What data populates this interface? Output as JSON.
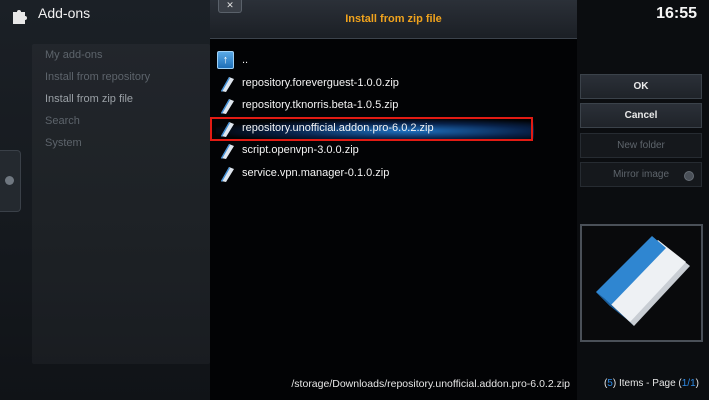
{
  "app": {
    "title": "Add-ons",
    "clock": "16:55"
  },
  "sidebar": {
    "items": [
      {
        "label": "My add-ons"
      },
      {
        "label": "Install from repository"
      },
      {
        "label": "Install from zip file"
      },
      {
        "label": "Search"
      },
      {
        "label": "System"
      }
    ],
    "selected": "Install from zip file"
  },
  "dialog": {
    "title": "Install from zip file",
    "close_label": "✕",
    "up_label": "..",
    "files": [
      {
        "name": "repository.foreverguest-1.0.0.zip"
      },
      {
        "name": "repository.tknorris.beta-1.0.5.zip"
      },
      {
        "name": "repository.unofficial.addon.pro-6.0.2.zip"
      },
      {
        "name": "script.openvpn-3.0.0.zip"
      },
      {
        "name": "service.vpn.manager-0.1.0.zip"
      }
    ],
    "highlighted": "repository.unofficial.addon.pro-6.0.2.zip",
    "path": "/storage/Downloads/repository.unofficial.addon.pro-6.0.2.zip"
  },
  "buttons": {
    "ok": "OK",
    "cancel": "Cancel",
    "new_folder": "New folder",
    "mirror_image": "Mirror image"
  },
  "footer": {
    "items_open": "(",
    "items_count": "5",
    "items_text": ") Items - Page (",
    "page": "1/1",
    "page_close": ")"
  },
  "colors": {
    "title_accent": "#f0a31d",
    "highlight_box": "#e21b13",
    "selection_glow": "#2896ff",
    "count_accent": "#2f8be6"
  },
  "icons": [
    "addon-puzzle-icon",
    "close-icon",
    "folder-up-icon",
    "zip-file-icon",
    "radio-dot-icon",
    "book-preview-icon"
  ]
}
